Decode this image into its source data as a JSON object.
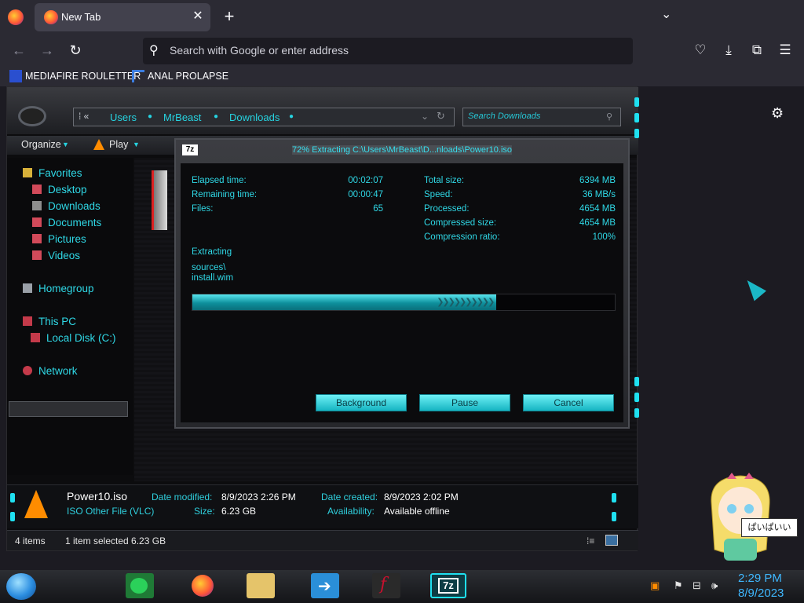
{
  "browser": {
    "tab_title": "New Tab",
    "url_placeholder": "Search with Google or enter address",
    "bookmarks": [
      "MEDIAFIRE ROULETTER",
      "ANAL PROLAPSE"
    ]
  },
  "explorer": {
    "breadcrumbs": [
      "Users",
      "MrBeast",
      "Downloads"
    ],
    "search_placeholder": "Search Downloads",
    "commands": [
      "Organize",
      "Play"
    ],
    "nav": {
      "favorites": "Favorites",
      "desktop": "Desktop",
      "downloads": "Downloads",
      "documents": "Documents",
      "pictures": "Pictures",
      "videos": "Videos",
      "homegroup": "Homegroup",
      "this_pc": "This PC",
      "local_disk": "Local Disk (C:)",
      "network": "Network"
    },
    "details": {
      "filename": "Power10.iso",
      "filetype": "ISO Other File (VLC)",
      "date_modified_label": "Date modified:",
      "date_modified": "8/9/2023 2:26 PM",
      "size_label": "Size:",
      "size": "6.23 GB",
      "date_created_label": "Date created:",
      "date_created": "8/9/2023 2:02 PM",
      "availability_label": "Availability:",
      "availability": "Available offline"
    },
    "status": {
      "items": "4 items",
      "selected": "1 item selected  6.23 GB"
    }
  },
  "dialog": {
    "icon_label": "7z",
    "title": "72% Extracting C:\\Users\\MrBeast\\D...nloads\\Power10.iso",
    "elapsed_label": "Elapsed time:",
    "elapsed": "00:02:07",
    "remaining_label": "Remaining time:",
    "remaining": "00:00:47",
    "files_label": "Files:",
    "files": "65",
    "total_label": "Total size:",
    "total": "6394 MB",
    "speed_label": "Speed:",
    "speed": "36 MB/s",
    "processed_label": "Processed:",
    "processed": "4654 MB",
    "compressed_label": "Compressed size:",
    "compressed": "4654 MB",
    "ratio_label": "Compression ratio:",
    "ratio": "100%",
    "action": "Extracting",
    "path1": "sources\\",
    "path2": "install.wim",
    "progress": 0.72,
    "buttons": {
      "background": "Background",
      "pause": "Pause",
      "cancel": "Cancel"
    }
  },
  "desktop": {
    "bubble": "ぱいぱいい"
  },
  "taskbar": {
    "time": "2:29 PM",
    "date": "8/9/2023"
  }
}
